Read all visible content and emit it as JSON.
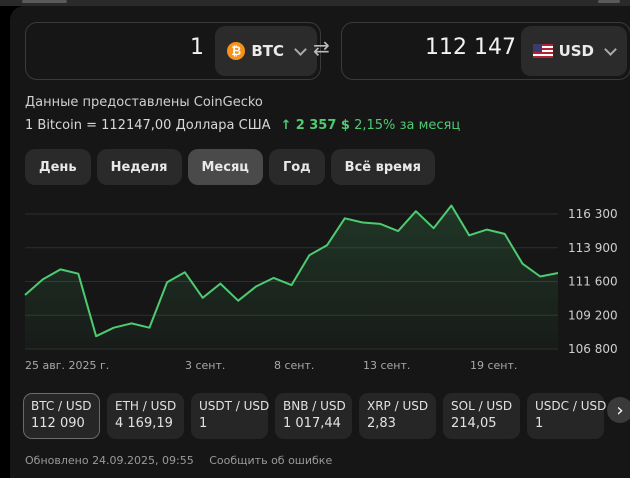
{
  "converter": {
    "from": {
      "amount": "1",
      "currency": "BTC",
      "icon": "bitcoin-icon"
    },
    "to": {
      "amount": "112 147",
      "currency": "USD",
      "icon": "us-flag-icon"
    },
    "swap_icon": "⇄"
  },
  "source_text": "Данные предоставлены CoinGecko",
  "rate": {
    "text": "1 Bitcoin = 112147,00 Доллара США",
    "change_arrow": "↑",
    "change_abs": "2 357 $",
    "change_pct": "2,15%",
    "change_period": "за месяц",
    "change_color": "#4ecb71"
  },
  "tabs": [
    {
      "label": "День",
      "active": false
    },
    {
      "label": "Неделя",
      "active": false
    },
    {
      "label": "Месяц",
      "active": true
    },
    {
      "label": "Год",
      "active": false
    },
    {
      "label": "Всё время",
      "active": false
    }
  ],
  "chart_data": {
    "type": "area",
    "x_labels": [
      "25 авг. 2025 г.",
      "3 сент.",
      "8 сент.",
      "13 сент.",
      "19 сент."
    ],
    "y_labels": [
      "116 300",
      "113 900",
      "111 600",
      "109 200",
      "106 800"
    ],
    "ylim": [
      106800,
      116300
    ],
    "grid": true,
    "values": [
      110600,
      111700,
      112400,
      112100,
      107700,
      108300,
      108600,
      108300,
      111500,
      112200,
      110400,
      111400,
      110200,
      111200,
      111800,
      111300,
      113400,
      114100,
      116000,
      115700,
      115600,
      115100,
      116500,
      115300,
      116900,
      114800,
      115200,
      114900,
      112800,
      111900,
      112150
    ],
    "line_color": "#4ecb71"
  },
  "pairs": [
    {
      "name": "BTC / USD",
      "value": "112 090",
      "active": true
    },
    {
      "name": "ETH / USD",
      "value": "4 169,19",
      "active": false
    },
    {
      "name": "USDT / USD",
      "value": "1",
      "active": false
    },
    {
      "name": "BNB / USD",
      "value": "1 017,44",
      "active": false
    },
    {
      "name": "XRP / USD",
      "value": "2,83",
      "active": false
    },
    {
      "name": "SOL / USD",
      "value": "214,05",
      "active": false
    },
    {
      "name": "USDC / USD",
      "value": "1",
      "active": false
    }
  ],
  "next_icon": "›",
  "footer": {
    "updated": "Обновлено 24.09.2025, 09:55",
    "report": "Сообщить об ошибке"
  }
}
